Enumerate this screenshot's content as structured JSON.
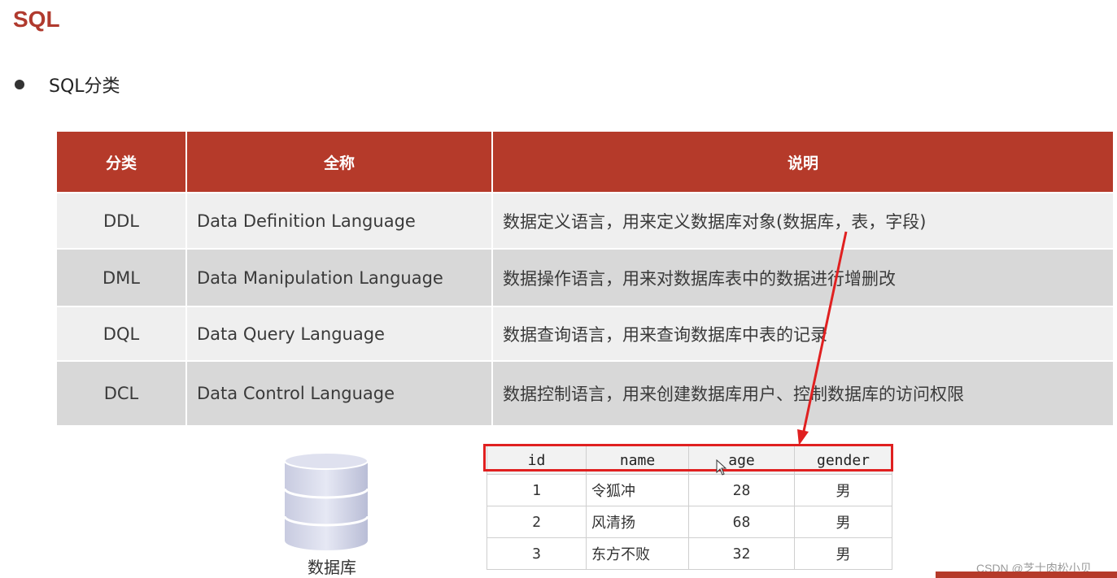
{
  "title": "SQL",
  "bullet": "SQL分类",
  "classification_table": {
    "headers": [
      "分类",
      "全称",
      "说明"
    ],
    "rows": [
      {
        "category": "DDL",
        "full_name": "Data Definition Language",
        "description": "数据定义语言，用来定义数据库对象(数据库，表，字段)"
      },
      {
        "category": "DML",
        "full_name": "Data Manipulation Language",
        "description": "数据操作语言，用来对数据库表中的数据进行增删改"
      },
      {
        "category": "DQL",
        "full_name": "Data Query Language",
        "description": "数据查询语言，用来查询数据库中表的记录"
      },
      {
        "category": "DCL",
        "full_name": "Data Control Language",
        "description": "数据控制语言，用来创建数据库用户、控制数据库的访问权限"
      }
    ]
  },
  "database_label": "数据库",
  "data_table": {
    "headers": [
      "id",
      "name",
      "age",
      "gender"
    ],
    "rows": [
      [
        "1",
        "令狐冲",
        "28",
        "男"
      ],
      [
        "2",
        "风清扬",
        "68",
        "男"
      ],
      [
        "3",
        "东方不败",
        "32",
        "男"
      ]
    ]
  },
  "watermark": "CSDN @芝士肉松小贝",
  "colors": {
    "title": "#b03a2e",
    "header_bg": "#b53a2a",
    "highlight": "#e02020"
  }
}
